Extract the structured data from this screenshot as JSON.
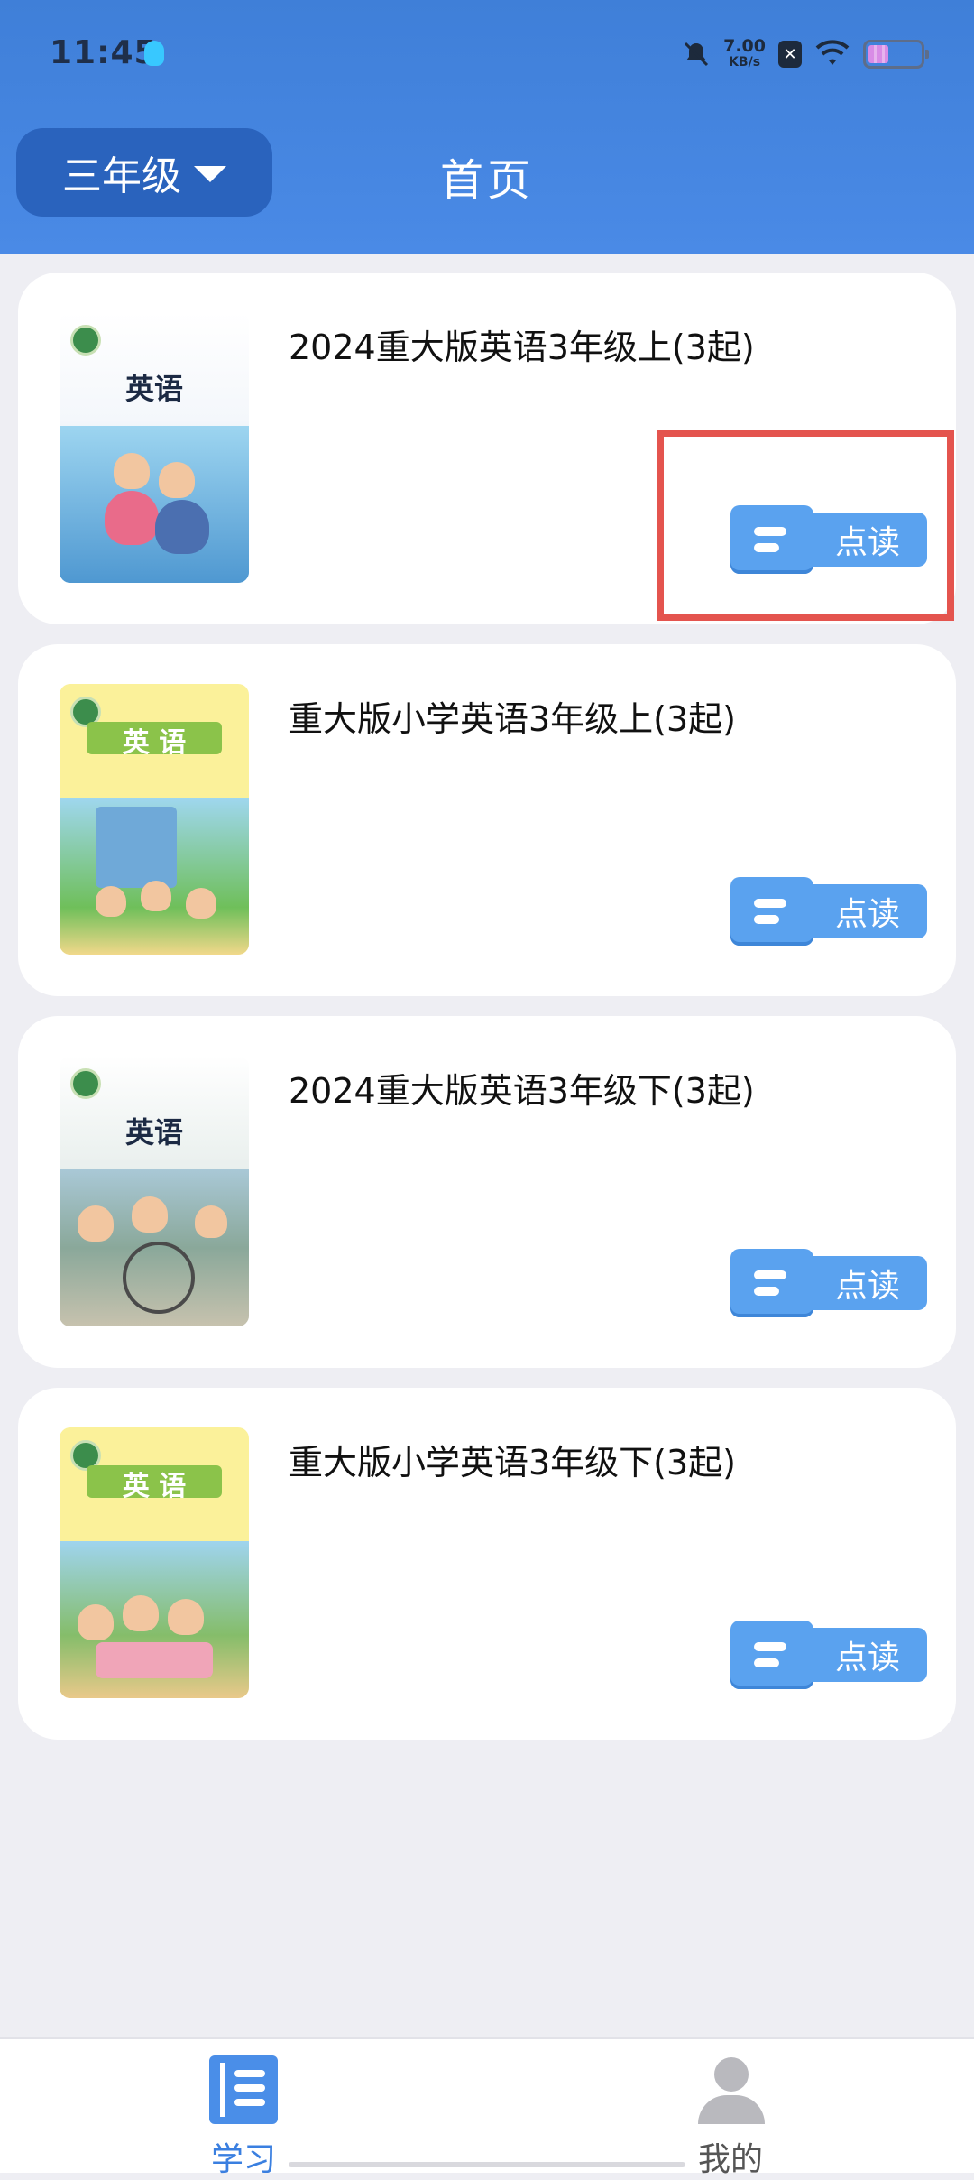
{
  "status_bar": {
    "time": "11:45",
    "net_speed_value": "7.00",
    "net_speed_unit": "KB/s",
    "battery_level": 0.4,
    "icons": [
      "qq-icon",
      "mute-icon",
      "x-badge-icon",
      "wifi-icon",
      "battery-icon"
    ]
  },
  "header": {
    "grade_label": "三年级",
    "title": "首页"
  },
  "books": [
    {
      "title": "2024重大版英语3年级上(3起)",
      "cover_text": "英语",
      "read_label": "点读"
    },
    {
      "title": "重大版小学英语3年级上(3起)",
      "cover_text": "英 语",
      "read_label": "点读"
    },
    {
      "title": "2024重大版英语3年级下(3起)",
      "cover_text": "英语",
      "read_label": "点读"
    },
    {
      "title": "重大版小学英语3年级下(3起)",
      "cover_text": "英 语",
      "read_label": "点读"
    }
  ],
  "tabbar": {
    "study_label": "学习",
    "mine_label": "我的"
  },
  "colors": {
    "header_blue": "#4a8ae6",
    "grade_button": "#2a63bd",
    "read_button": "#5aa2ef",
    "highlight_red": "#e4544e",
    "active_tab": "#3a7fe0"
  }
}
